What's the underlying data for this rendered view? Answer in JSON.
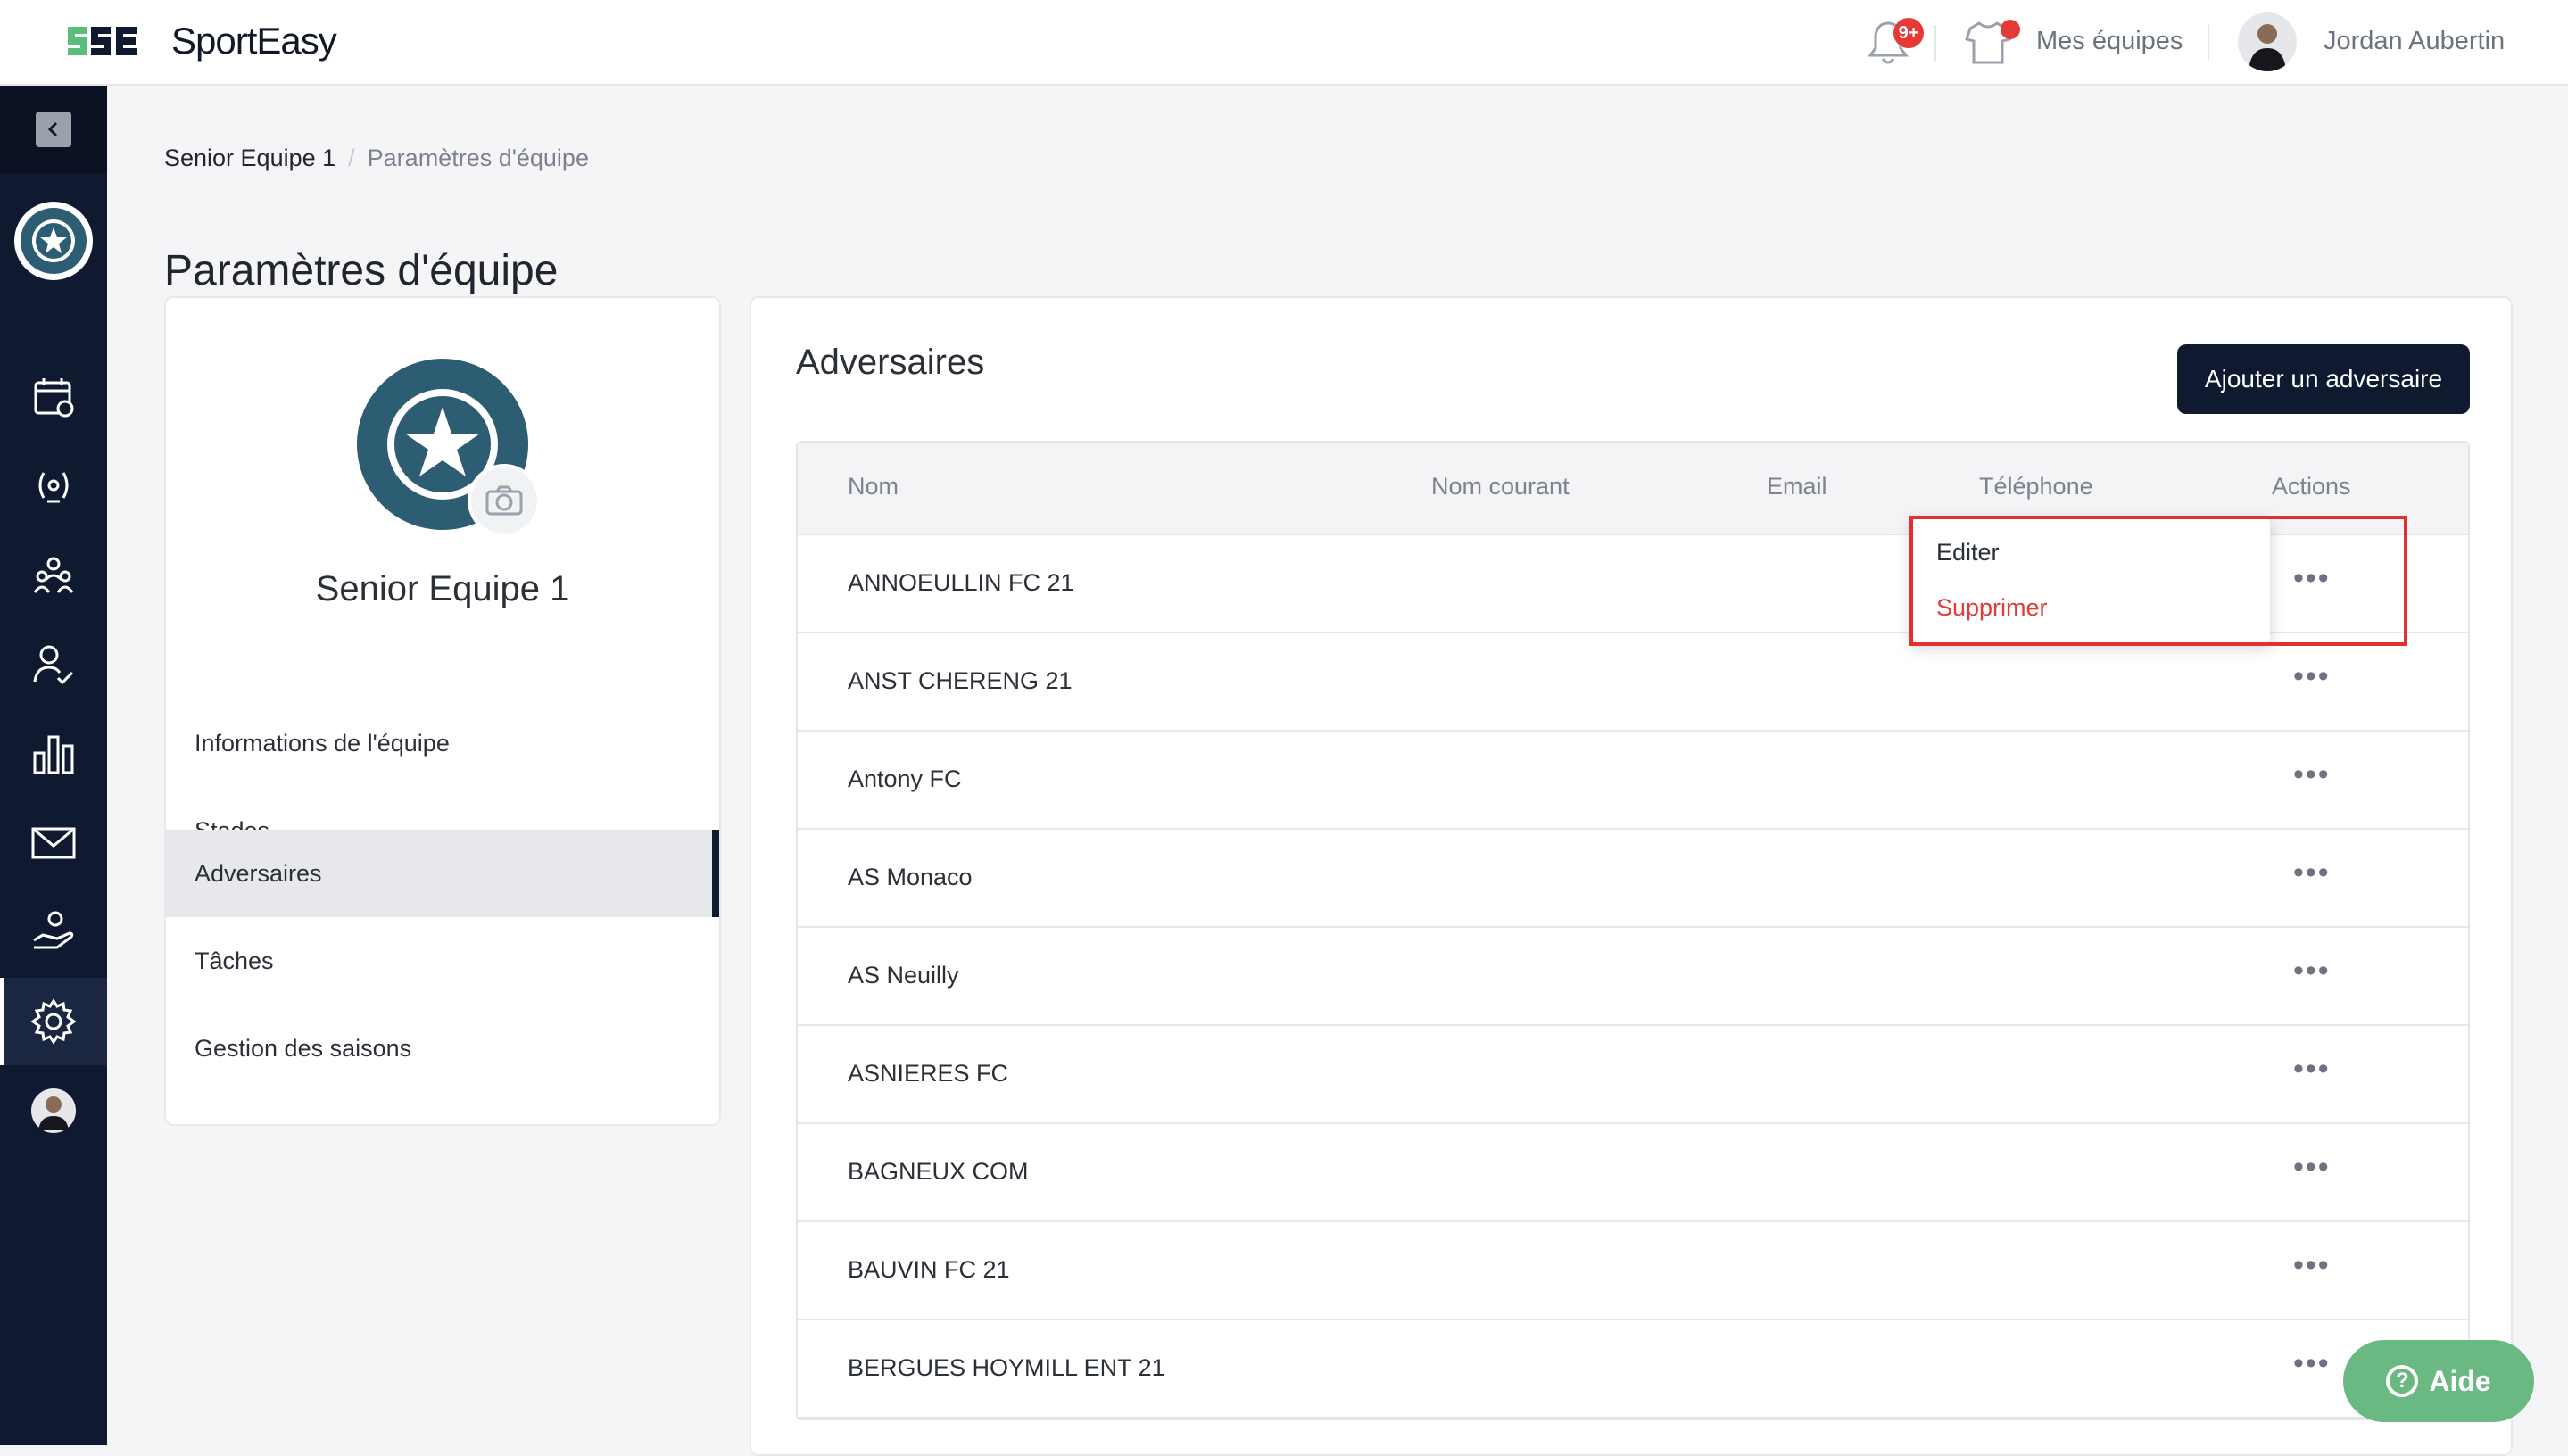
{
  "app": {
    "name": "SportEasy"
  },
  "header": {
    "notifications_badge": "9+",
    "teams_label": "Mes équipes",
    "user_name": "Jordan Aubertin"
  },
  "breadcrumb": {
    "team": "Senior Equipe 1",
    "separator": "/",
    "page": "Paramètres d'équipe"
  },
  "page_title": "Paramètres d'équipe",
  "team_card": {
    "team_name": "Senior Equipe 1",
    "menu": [
      {
        "label": "Informations de l'équipe"
      },
      {
        "label": "Stades"
      },
      {
        "label": "Adversaires"
      },
      {
        "label": "Tâches"
      },
      {
        "label": "Gestion des saisons"
      }
    ]
  },
  "opponents": {
    "title": "Adversaires",
    "add_button": "Ajouter un adversaire",
    "columns": [
      "Nom",
      "Nom courant",
      "Email",
      "Téléphone",
      "Actions"
    ],
    "rows": [
      {
        "name": "ANNOEULLIN FC 21"
      },
      {
        "name": "ANST CHERENG 21"
      },
      {
        "name": "Antony FC"
      },
      {
        "name": "AS Monaco"
      },
      {
        "name": "AS Neuilly"
      },
      {
        "name": "ASNIERES FC"
      },
      {
        "name": "BAGNEUX COM"
      },
      {
        "name": "BAUVIN FC 21"
      },
      {
        "name": "BERGUES HOYMILL ENT 21"
      }
    ],
    "actions_glyph": "•••"
  },
  "dropdown": {
    "edit": "Editer",
    "delete": "Supprimer"
  },
  "help": {
    "label": "Aide",
    "icon": "?"
  },
  "colors": {
    "navy": "#0f1a30",
    "danger": "#e23b3b",
    "help_green": "#6ab882",
    "brand_green": "#5bbd7a"
  },
  "icons": [
    "bell-icon",
    "shirt-icon",
    "calendar-icon",
    "trophy-icon",
    "team-icon",
    "player-icon",
    "stats-icon",
    "mail-icon",
    "sponsor-icon",
    "gear-icon",
    "camera-icon"
  ]
}
